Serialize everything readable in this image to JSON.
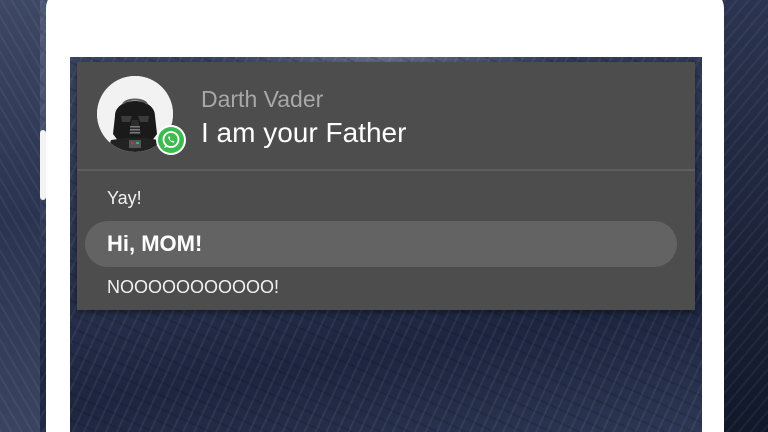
{
  "notification": {
    "app_icon": "whatsapp-icon",
    "avatar_icon": "darth-vader-avatar",
    "sender": "Darth Vader",
    "title": "I am your Father",
    "messages": [
      {
        "text": "Yay!",
        "highlighted": false
      },
      {
        "text": "Hi, MOM!",
        "highlighted": true
      },
      {
        "text": "NOOOOOOOOOOO!",
        "highlighted": false
      }
    ]
  },
  "colors": {
    "notification_bg": "#4d4d4d",
    "highlight_bg": "#636363",
    "badge_green": "#3dbb4f",
    "sender_text": "#a8a8a8"
  }
}
